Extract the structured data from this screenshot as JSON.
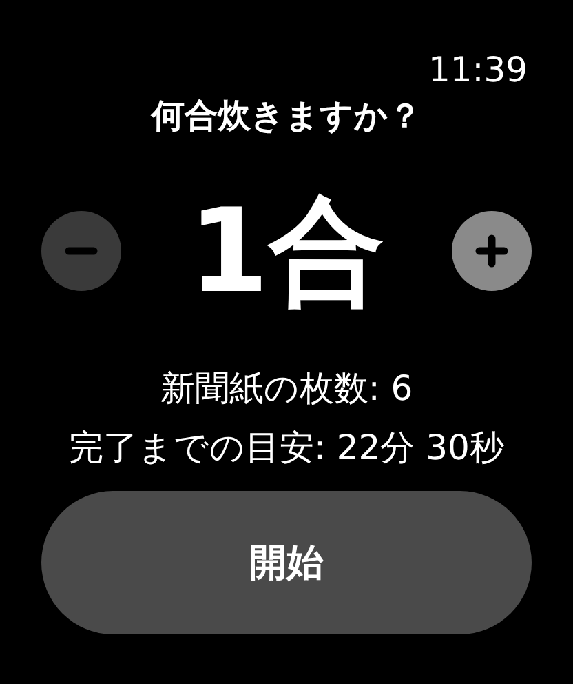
{
  "status_bar": {
    "time": "11:39"
  },
  "title": "何合炊きますか？",
  "stepper": {
    "value": "1合",
    "buttons": [
      {
        "kind": "minus",
        "disabled": true
      },
      {
        "kind": "plus",
        "disabled": false
      }
    ]
  },
  "info": [
    "新聞紙の枚数: 6",
    "完了までの目安: 22分 30秒"
  ],
  "start_button": {
    "label": "開始"
  }
}
